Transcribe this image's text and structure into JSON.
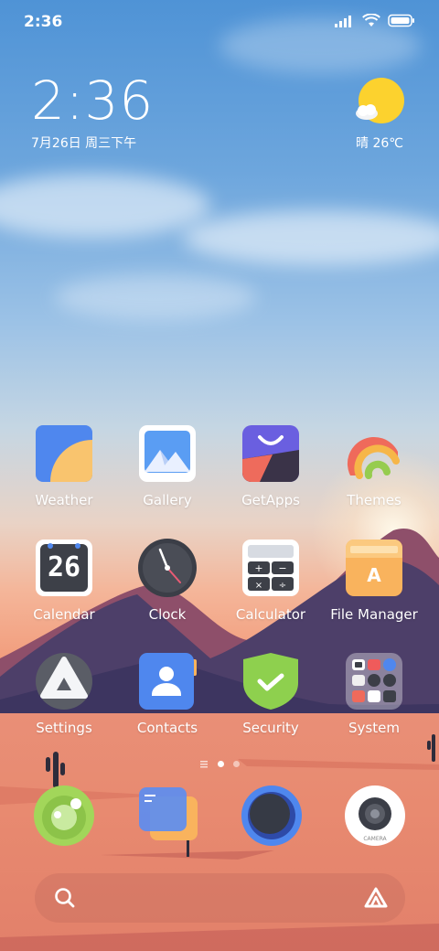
{
  "status_bar": {
    "time": "2:36"
  },
  "clock_widget": {
    "time": "2:36",
    "date": "7月26日 周三下午"
  },
  "weather_widget": {
    "condition_temp": "晴 26℃",
    "icon": "sun-cloud-icon"
  },
  "apps": [
    {
      "label": "Weather",
      "icon": "weather-icon"
    },
    {
      "label": "Gallery",
      "icon": "gallery-icon"
    },
    {
      "label": "GetApps",
      "icon": "getapps-icon"
    },
    {
      "label": "Themes",
      "icon": "themes-icon"
    },
    {
      "label": "Calendar",
      "icon": "calendar-icon",
      "day": "26"
    },
    {
      "label": "Clock",
      "icon": "clock-icon"
    },
    {
      "label": "Calculator",
      "icon": "calculator-icon"
    },
    {
      "label": "File Manager",
      "icon": "file-manager-icon",
      "letter": "A"
    },
    {
      "label": "Settings",
      "icon": "settings-icon"
    },
    {
      "label": "Contacts",
      "icon": "contacts-icon"
    },
    {
      "label": "Security",
      "icon": "security-icon"
    },
    {
      "label": "System",
      "icon": "system-folder-icon"
    }
  ],
  "dock": [
    {
      "icon": "messaging-icon"
    },
    {
      "icon": "notes-icon"
    },
    {
      "icon": "browser-icon"
    },
    {
      "icon": "camera-icon",
      "text": "CAMERA"
    }
  ],
  "page_indicator": {
    "pages": 2,
    "current": 1
  },
  "colors": {
    "weather_blue": "#4f87ee",
    "getapps_purple": "#6a5fe0",
    "security_green": "#8ed04e",
    "file_yellow": "#f9b35d"
  }
}
